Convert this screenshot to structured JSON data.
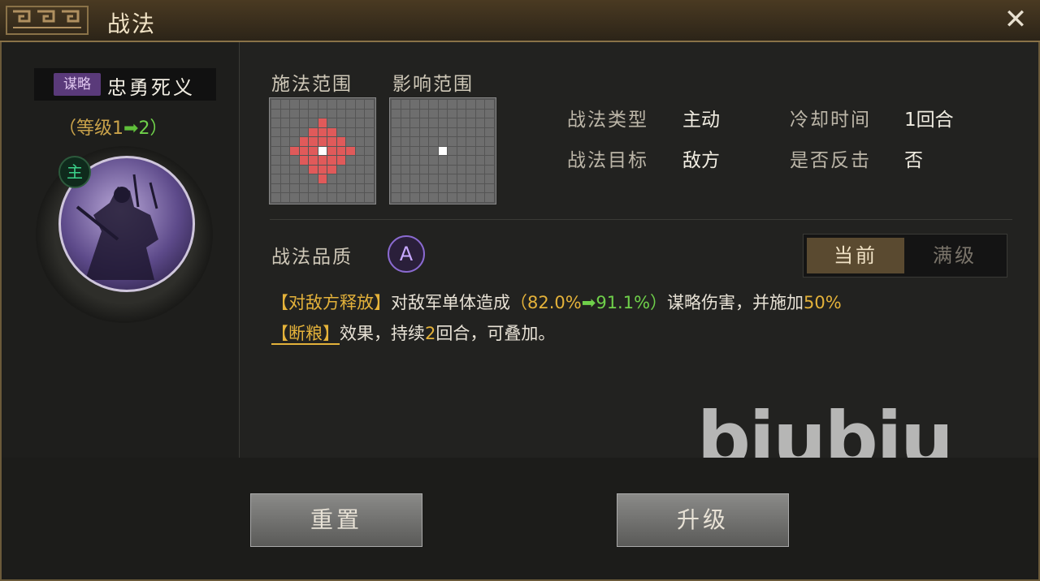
{
  "title": "战法",
  "close_icon": "close-icon",
  "skill": {
    "tag": "谋略",
    "name": "忠勇死义",
    "level_prefix": "（等级1",
    "level_arrow": "➡",
    "level_to": "2）",
    "main_badge": "主"
  },
  "ranges": {
    "cast_label": "施法范围",
    "effect_label": "影响范围"
  },
  "info": {
    "type_label": "战法类型",
    "type_value": "主动",
    "cooldown_label": "冷却时间",
    "cooldown_value": "1回合",
    "target_label": "战法目标",
    "target_value": "敌方",
    "counter_label": "是否反击",
    "counter_value": "否"
  },
  "quality": {
    "label": "战法品质",
    "grade": "A"
  },
  "toggle": {
    "current": "当前",
    "max": "满级"
  },
  "description": {
    "part1": "【对敌方释放】",
    "part2": "对敌军单体造成",
    "part3": "（82.0%",
    "part4": "➡",
    "part5": "91.1%）",
    "part6": "谋略伤害，并施加",
    "part7": "50%",
    "part8": "【断粮】",
    "part9": "效果，持续",
    "part10": "2",
    "part11": "回合，可叠加。"
  },
  "watermark": "biubiu",
  "buttons": {
    "reset": "重置",
    "upgrade": "升级"
  },
  "colors": {
    "accent_gold": "#e4b23a",
    "green": "#6fd04a",
    "range_red": "#e05a5a"
  }
}
